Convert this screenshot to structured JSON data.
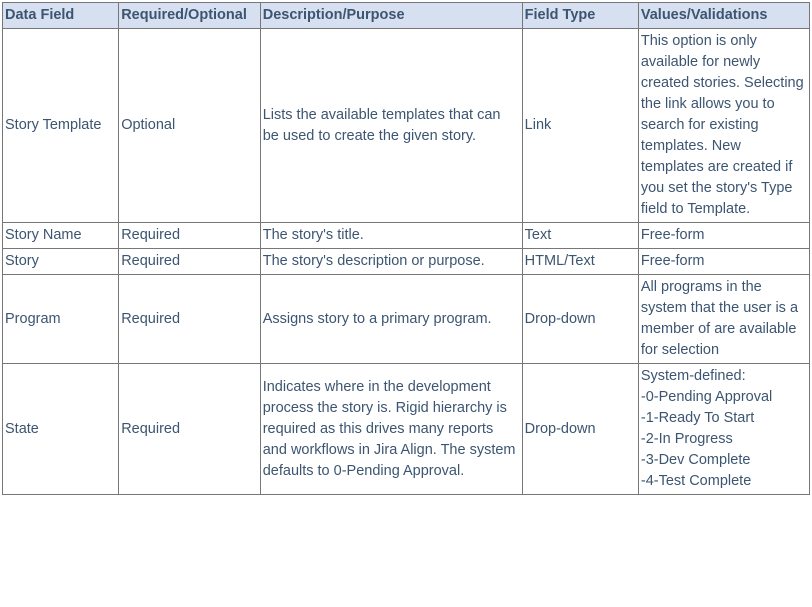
{
  "headers": {
    "c1": "Data Field",
    "c2": "Required/Optional",
    "c3": "Description/Purpose",
    "c4": "Field Type",
    "c5": "Values/Validations"
  },
  "rows": [
    {
      "field": "Story Template",
      "required": "Optional",
      "description": "Lists the available templates that can be used to create the given story.",
      "type": "Link",
      "values": "This option is only available for newly created stories. Selecting the link allows you to search for existing templates. New templates are created if you set the story's Type field to Template."
    },
    {
      "field": "Story Name",
      "required": "Required",
      "description": "The story's title.",
      "type": "Text",
      "values": "Free-form"
    },
    {
      "field": "Story",
      "required": "Required",
      "description": "The story's description or purpose.",
      "type": "HTML/Text",
      "values": "Free-form"
    },
    {
      "field": "Program",
      "required": "Required",
      "description": "Assigns story to a primary program.",
      "type": "Drop-down",
      "values": "All programs in the system that the user is a member of are available for selection"
    },
    {
      "field": "State",
      "required": "Required",
      "description": "Indicates where in the development process the story is. Rigid hierarchy is required as this drives many reports and workflows in Jira Align. The system defaults to 0-Pending Approval.",
      "type": "Drop-down",
      "values": "System-defined:\n-0-Pending Approval\n-1-Ready To Start\n-2-In Progress\n-3-Dev Complete\n-4-Test Complete"
    }
  ]
}
